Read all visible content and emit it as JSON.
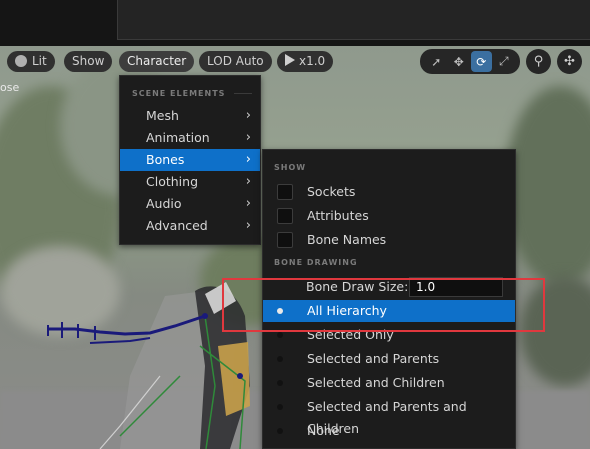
{
  "toolbar": {
    "lit": "Lit",
    "show": "Show",
    "character": "Character",
    "lod": "LOD Auto",
    "speed": "x1.0"
  },
  "transform_icons": [
    "select-icon",
    "move-icon",
    "rotate-icon",
    "scale-icon"
  ],
  "viewport": {
    "left_label": "ose"
  },
  "character_menu": {
    "section": "SCENE ELEMENTS",
    "items": [
      {
        "label": "Mesh",
        "selected": false
      },
      {
        "label": "Animation",
        "selected": false
      },
      {
        "label": "Bones",
        "selected": true
      },
      {
        "label": "Clothing",
        "selected": false
      },
      {
        "label": "Audio",
        "selected": false
      },
      {
        "label": "Advanced",
        "selected": false
      }
    ]
  },
  "bones_menu": {
    "show_section": "SHOW",
    "show_items": [
      {
        "label": "Sockets",
        "checked": false
      },
      {
        "label": "Attributes",
        "checked": false
      },
      {
        "label": "Bone Names",
        "checked": false
      }
    ],
    "drawing_section": "BONE DRAWING",
    "draw_size_label": "Bone Draw Size:",
    "draw_size_value": "1.0",
    "hierarchy_items": [
      {
        "label": "All Hierarchy",
        "selected": true
      },
      {
        "label": "Selected Only",
        "selected": false
      },
      {
        "label": "Selected and Parents",
        "selected": false
      },
      {
        "label": "Selected and Children",
        "selected": false
      },
      {
        "label": "Selected and Parents and Children",
        "selected": false
      },
      {
        "label": "None",
        "selected": false
      }
    ]
  },
  "colors": {
    "accent": "#0e70c9",
    "menu_bg": "#1c1c1c",
    "highlight_box": "#e0383e"
  }
}
